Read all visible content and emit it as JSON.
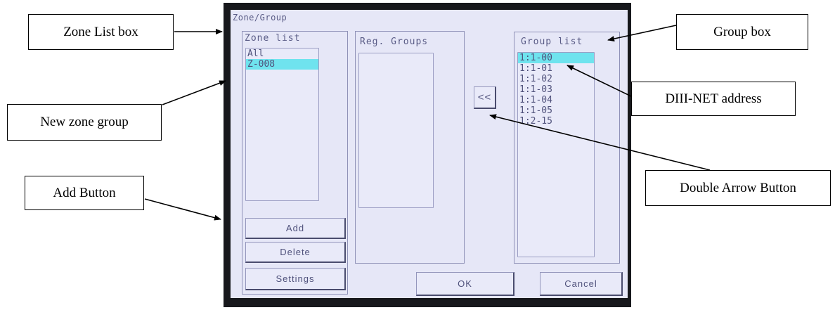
{
  "screen": {
    "title": "Zone/Group",
    "zone_panel": {
      "label": "Zone list",
      "items": [
        {
          "label": "All",
          "selected": false
        },
        {
          "label": "Z-008",
          "selected": true
        }
      ]
    },
    "reg_panel": {
      "label": "Reg. Groups",
      "items": []
    },
    "group_panel": {
      "label": "Group list",
      "items": [
        {
          "label": "1:1-00",
          "selected": true
        },
        {
          "label": "1:1-01",
          "selected": false
        },
        {
          "label": "1:1-02",
          "selected": false
        },
        {
          "label": "1:1-03",
          "selected": false
        },
        {
          "label": "1:1-04",
          "selected": false
        },
        {
          "label": "1:1-05",
          "selected": false
        },
        {
          "label": "1:2-15",
          "selected": false
        }
      ]
    },
    "buttons": {
      "add": "Add",
      "delete": "Delete",
      "settings": "Settings",
      "move": "<<",
      "ok": "OK",
      "cancel": "Cancel"
    },
    "highlight_color": "#6fe3ee"
  },
  "callouts": {
    "zone_list_box": "Zone List box",
    "new_zone_group": "New zone group",
    "add_button": "Add Button",
    "group_box": "Group box",
    "diii_net_address": "DIII-NET address",
    "double_arrow_button": "Double Arrow Button"
  }
}
